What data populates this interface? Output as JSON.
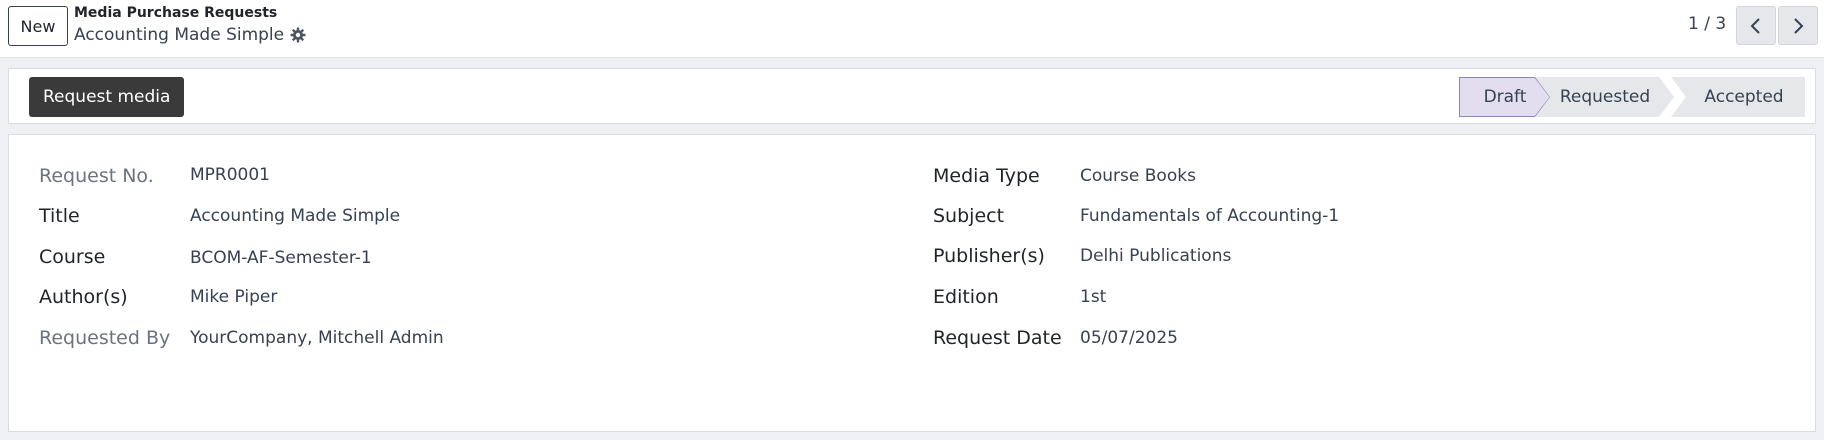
{
  "control_panel": {
    "new_label": "New",
    "breadcrumb": "Media Purchase Requests",
    "record_title": "Accounting Made Simple",
    "settings_icon": "gear-icon",
    "pager": "1 / 3",
    "prev_icon": "chevron-left-icon",
    "next_icon": "chevron-right-icon"
  },
  "status_bar": {
    "action_label": "Request media",
    "stages": [
      {
        "label": "Draft",
        "active": true
      },
      {
        "label": "Requested",
        "active": false
      },
      {
        "label": "Accepted",
        "active": false
      }
    ]
  },
  "form": {
    "left": [
      {
        "label": "Request No.",
        "value": "MPR0001",
        "readonly": true
      },
      {
        "label": "Title",
        "value": "Accounting Made Simple",
        "readonly": false
      },
      {
        "label": "Course",
        "value": "BCOM-AF-Semester-1",
        "readonly": false
      },
      {
        "label": "Author(s)",
        "value": "Mike Piper",
        "readonly": false
      },
      {
        "label": "Requested By",
        "value": "YourCompany, Mitchell Admin",
        "readonly": true
      }
    ],
    "right": [
      {
        "label": "Media Type",
        "value": "Course Books"
      },
      {
        "label": "Subject",
        "value": "Fundamentals of Accounting-1"
      },
      {
        "label": "Publisher(s)",
        "value": "Delhi Publications"
      },
      {
        "label": "Edition",
        "value": "1st"
      },
      {
        "label": "Request Date",
        "value": "05/07/2025"
      }
    ]
  },
  "colors": {
    "active_stage_bg": "#e2def0",
    "active_stage_border": "#8f86b8",
    "inactive_stage_bg": "#e5e7eb",
    "action_button_bg": "#3a3a3a"
  }
}
